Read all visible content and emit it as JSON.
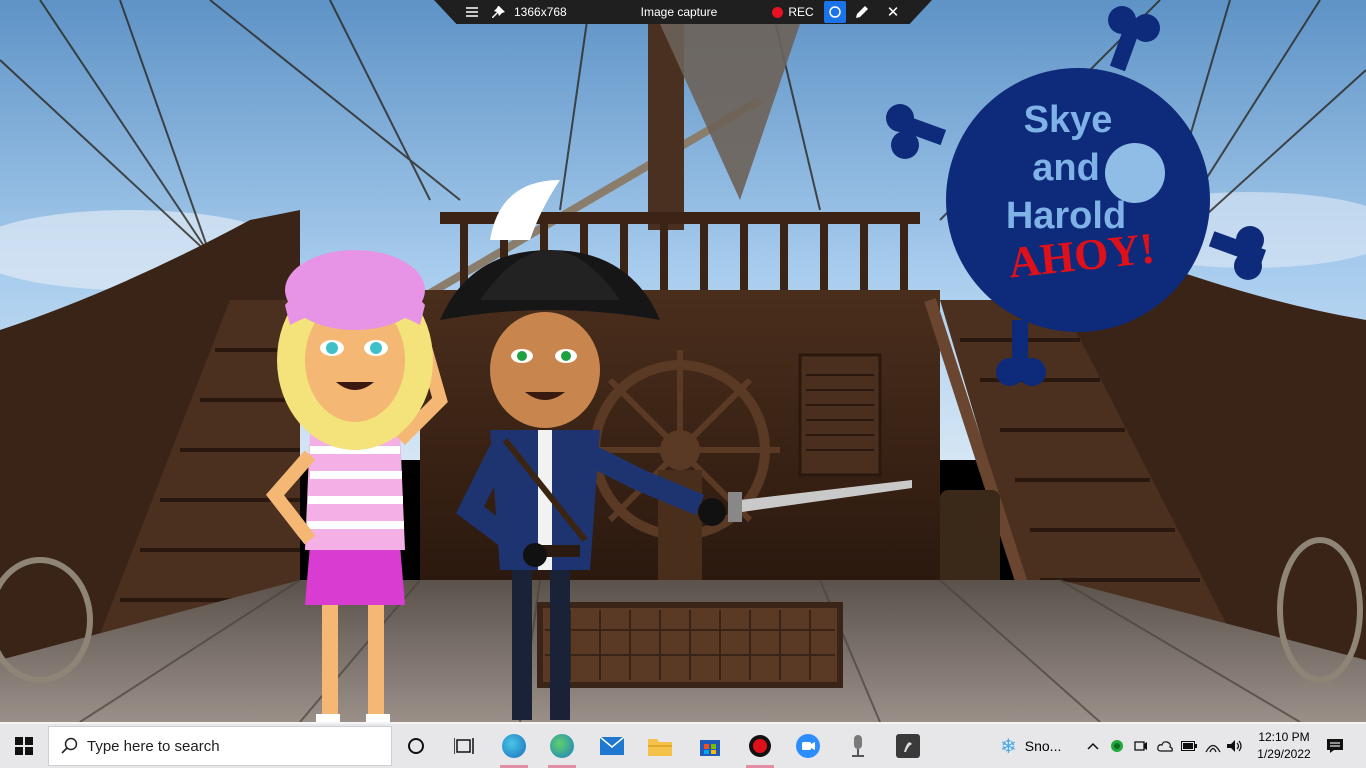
{
  "capture_toolbar": {
    "resolution": "1366x768",
    "mode_label": "Image capture",
    "rec_label": "REC",
    "icons": [
      "menu-icon",
      "pin-icon",
      "camera-icon",
      "pen-icon",
      "close-icon"
    ]
  },
  "scene": {
    "logo": {
      "line1": "Skye",
      "line2": "and",
      "line3": "Harold",
      "line4": "AHOY!"
    },
    "colors": {
      "sky": "#8fbde6",
      "wood_dark": "#3a2518",
      "wood_mid": "#6b4a33",
      "deck": "#7a6e66",
      "logo_blue": "#0e2a7a",
      "logo_text": "#7fb2e6",
      "ahoy_red": "#e0101a"
    }
  },
  "taskbar": {
    "search_placeholder": "Type here to search",
    "apps": [
      "task-view-icon",
      "edge-dev-icon",
      "edge-icon",
      "mail-icon",
      "file-explorer-icon",
      "store-icon",
      "recorder-icon",
      "zoom-icon",
      "microphone-app-icon",
      "app-icon"
    ],
    "weather_label": "Sno...",
    "time": "12:10 PM",
    "date": "1/29/2022"
  }
}
